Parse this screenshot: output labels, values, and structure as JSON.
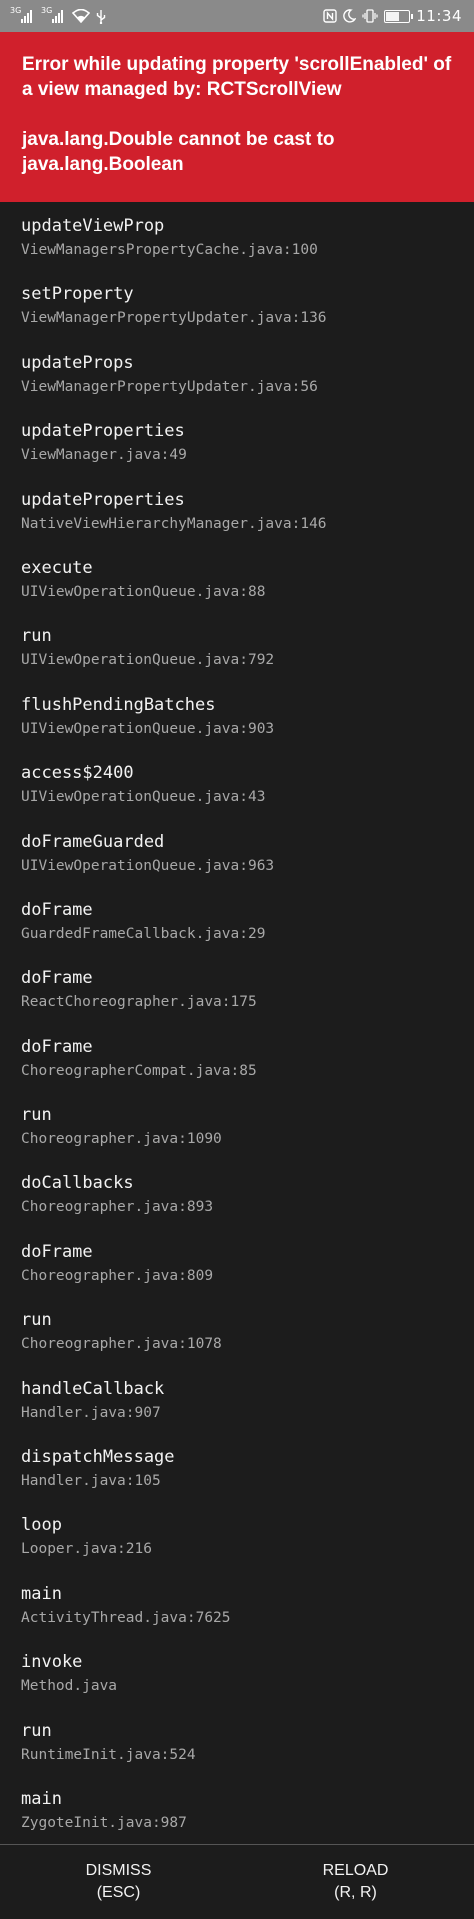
{
  "status_bar": {
    "signal_1_tag": "3G",
    "signal_2_tag": "3G",
    "time": "11:34",
    "icons": [
      "signal-icon",
      "signal-icon",
      "wifi-icon",
      "usb-icon",
      "nfc-icon",
      "moon-icon",
      "vibrate-icon",
      "battery-icon"
    ]
  },
  "error": {
    "title": "Error while updating property 'scrollEnabled' of a view managed by: RCTScrollView",
    "message": "java.lang.Double cannot be cast to java.lang.Boolean",
    "background_color": "#d0202c"
  },
  "stack": [
    {
      "method": "updateViewProp",
      "location": "ViewManagersPropertyCache.java:100"
    },
    {
      "method": "setProperty",
      "location": "ViewManagerPropertyUpdater.java:136"
    },
    {
      "method": "updateProps",
      "location": "ViewManagerPropertyUpdater.java:56"
    },
    {
      "method": "updateProperties",
      "location": "ViewManager.java:49"
    },
    {
      "method": "updateProperties",
      "location": "NativeViewHierarchyManager.java:146"
    },
    {
      "method": "execute",
      "location": "UIViewOperationQueue.java:88"
    },
    {
      "method": "run",
      "location": "UIViewOperationQueue.java:792"
    },
    {
      "method": "flushPendingBatches",
      "location": "UIViewOperationQueue.java:903"
    },
    {
      "method": "access$2400",
      "location": "UIViewOperationQueue.java:43"
    },
    {
      "method": "doFrameGuarded",
      "location": "UIViewOperationQueue.java:963"
    },
    {
      "method": "doFrame",
      "location": "GuardedFrameCallback.java:29"
    },
    {
      "method": "doFrame",
      "location": "ReactChoreographer.java:175"
    },
    {
      "method": "doFrame",
      "location": "ChoreographerCompat.java:85"
    },
    {
      "method": "run",
      "location": "Choreographer.java:1090"
    },
    {
      "method": "doCallbacks",
      "location": "Choreographer.java:893"
    },
    {
      "method": "doFrame",
      "location": "Choreographer.java:809"
    },
    {
      "method": "run",
      "location": "Choreographer.java:1078"
    },
    {
      "method": "handleCallback",
      "location": "Handler.java:907"
    },
    {
      "method": "dispatchMessage",
      "location": "Handler.java:105"
    },
    {
      "method": "loop",
      "location": "Looper.java:216"
    },
    {
      "method": "main",
      "location": "ActivityThread.java:7625"
    },
    {
      "method": "invoke",
      "location": "Method.java"
    },
    {
      "method": "run",
      "location": "RuntimeInit.java:524"
    },
    {
      "method": "main",
      "location": "ZygoteInit.java:987"
    }
  ],
  "footer": {
    "dismiss_label": "DISMISS",
    "dismiss_shortcut": "(ESC)",
    "reload_label": "RELOAD",
    "reload_shortcut": "(R, R)"
  }
}
